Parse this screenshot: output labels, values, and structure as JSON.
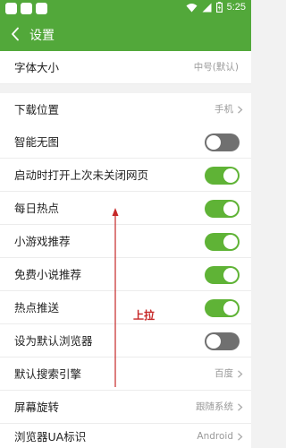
{
  "status_bar": {
    "time": "5:25"
  },
  "header": {
    "title": "设置"
  },
  "rows": [
    {
      "label": "字体大小",
      "value": "中号(默认)",
      "control": "value"
    },
    {
      "label": "下载位置",
      "value": "手机",
      "control": "chevron"
    },
    {
      "label": "智能无图",
      "control": "toggle",
      "on": false
    },
    {
      "label": "启动时打开上次未关闭网页",
      "control": "toggle",
      "on": true
    },
    {
      "label": "每日热点",
      "control": "toggle",
      "on": true
    },
    {
      "label": "小游戏推荐",
      "control": "toggle",
      "on": true
    },
    {
      "label": "免费小说推荐",
      "control": "toggle",
      "on": true
    },
    {
      "label": "热点推送",
      "control": "toggle",
      "on": true
    },
    {
      "label": "设为默认浏览器",
      "control": "toggle",
      "on": false
    },
    {
      "label": "默认搜索引擎",
      "value": "百度",
      "control": "chevron"
    },
    {
      "label": "屏幕旋转",
      "value": "跟随系统",
      "control": "chevron"
    },
    {
      "label": "浏览器UA标识",
      "value": "Android",
      "control": "chevron"
    }
  ],
  "annotation": {
    "text": "上拉",
    "color": "#c62828"
  },
  "colors": {
    "accent": "#52a83a",
    "toggle_on": "#5fb336",
    "toggle_off": "#707070"
  }
}
